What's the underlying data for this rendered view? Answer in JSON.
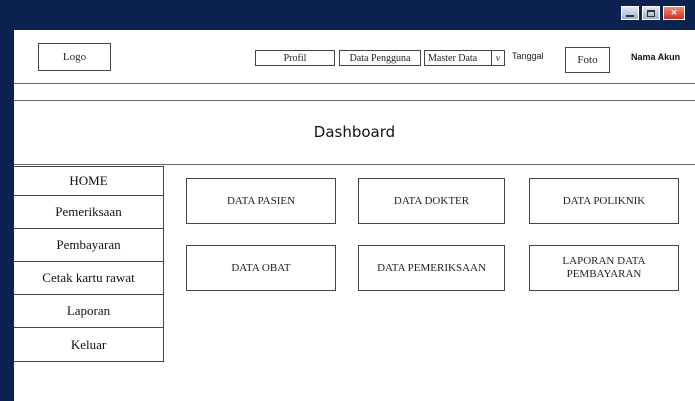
{
  "window_controls": {
    "minimize": "minimize-icon",
    "maximize": "maximize-icon",
    "close": "close-icon",
    "close_glyph": "×"
  },
  "header": {
    "logo": "Logo",
    "nav": {
      "profil": "Profil",
      "data_pengguna": "Data Pengguna",
      "master_data": "Master Data",
      "master_data_arrow": "v"
    },
    "tanggal": "Tanggal",
    "foto": "Foto",
    "nama_akun": "Nama Akun"
  },
  "page_title": "Dashboard",
  "sidebar": {
    "items": [
      {
        "label": "HOME"
      },
      {
        "label": "Pemeriksaan"
      },
      {
        "label": "Pembayaran"
      },
      {
        "label": "Cetak kartu rawat"
      },
      {
        "label": "Laporan"
      },
      {
        "label": "Keluar"
      }
    ]
  },
  "cards": [
    {
      "label": "DATA PASIEN"
    },
    {
      "label": "DATA DOKTER"
    },
    {
      "label": "DATA POLIKNIK"
    },
    {
      "label": "DATA OBAT"
    },
    {
      "label": "DATA PEMERIKSAAN"
    },
    {
      "label": "LAPORAN DATA PEMBAYARAN"
    }
  ],
  "colors": {
    "frame": "#0b2150",
    "close_button": "#c7321f"
  }
}
